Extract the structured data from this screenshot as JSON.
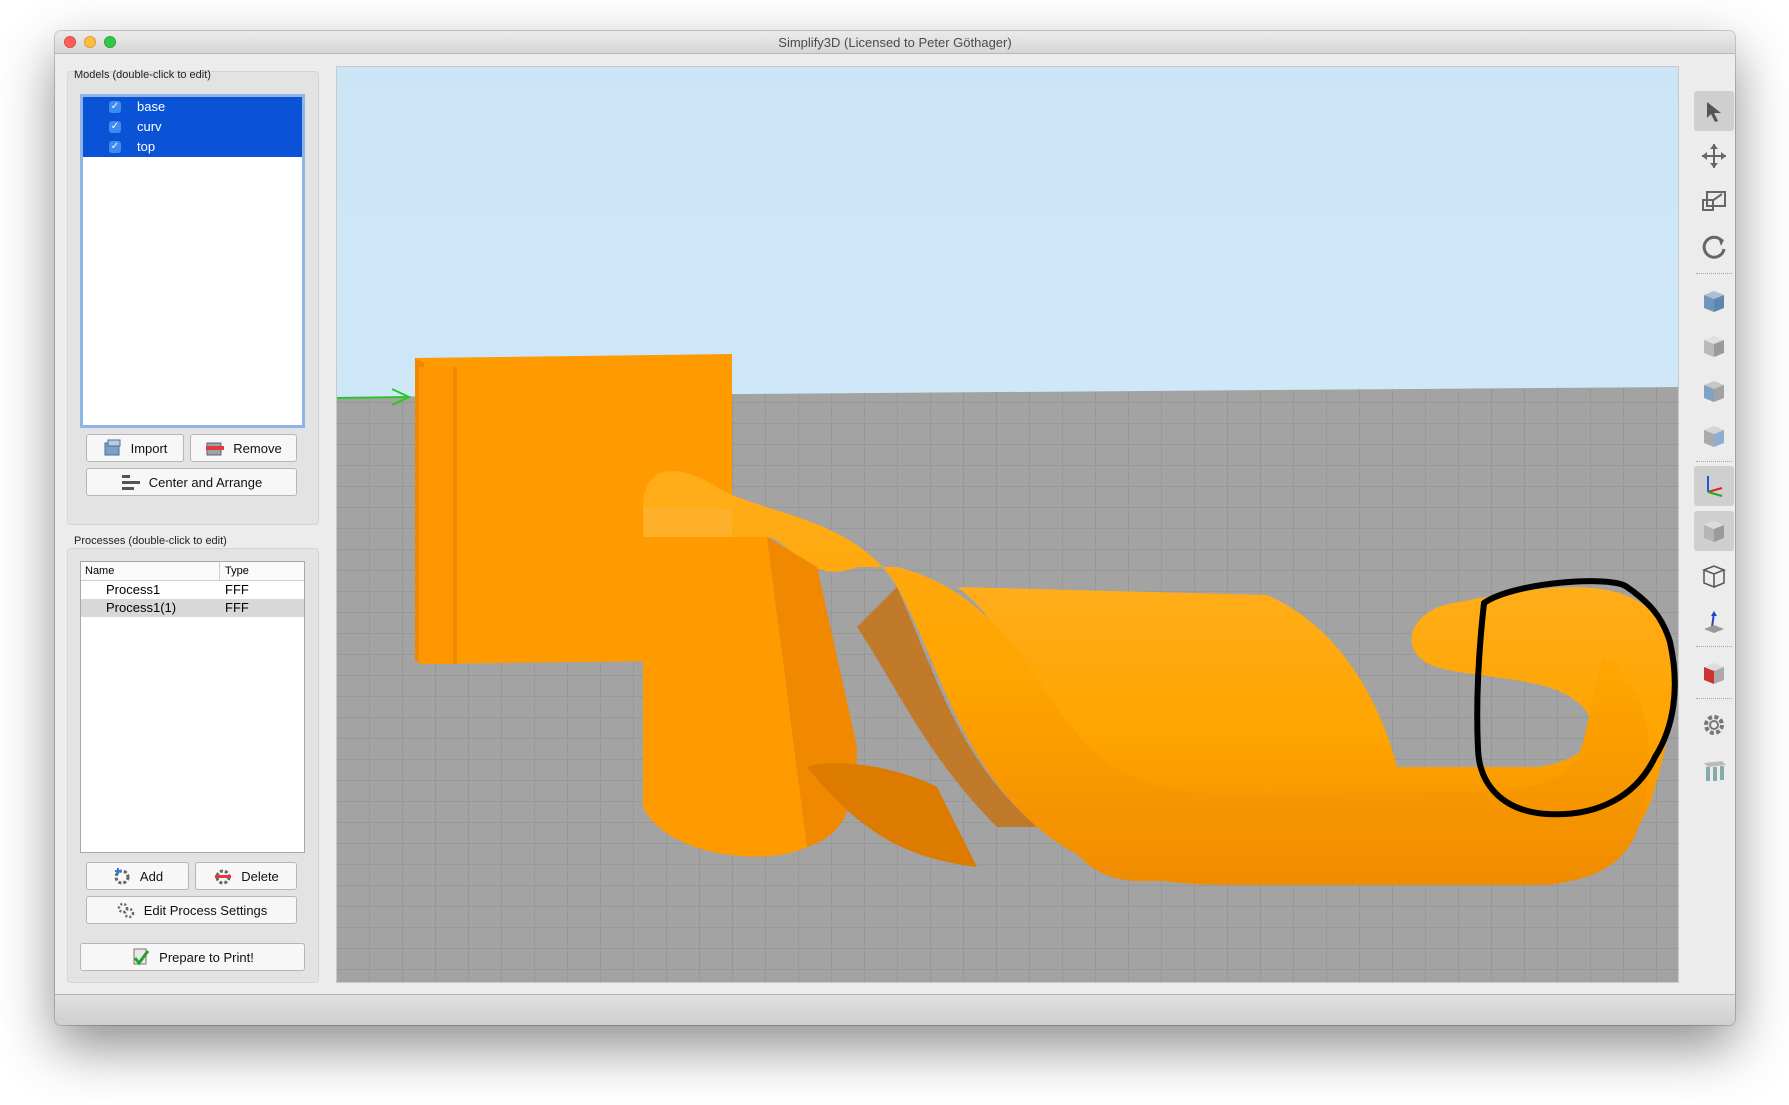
{
  "window": {
    "title": "Simplify3D (Licensed to Peter Göthager)"
  },
  "models": {
    "label": "Models (double-click to edit)",
    "items": [
      {
        "name": "base",
        "checked": true
      },
      {
        "name": "curv",
        "checked": true
      },
      {
        "name": "top",
        "checked": true
      }
    ],
    "import_label": "Import",
    "remove_label": "Remove",
    "center_label": "Center and Arrange"
  },
  "processes": {
    "label": "Processes (double-click to edit)",
    "columns": [
      "Name",
      "Type"
    ],
    "rows": [
      {
        "name": "Process1",
        "type": "FFF",
        "selected": false
      },
      {
        "name": "Process1(1)",
        "type": "FFF",
        "selected": true
      }
    ],
    "add_label": "Add",
    "delete_label": "Delete",
    "edit_label": "Edit Process Settings",
    "prepare_label": "Prepare to Print!"
  },
  "toolbar": {
    "tools": [
      "select-icon",
      "move-icon",
      "scale-icon",
      "rotate-icon",
      "view-top-icon",
      "view-front-icon",
      "view-side-icon",
      "view-iso-icon",
      "axes-icon",
      "solid-view-icon",
      "wireframe-icon",
      "normals-icon",
      "cross-section-icon",
      "settings-gear-icon",
      "supports-icon"
    ]
  },
  "colors": {
    "model": "#ff9a00",
    "sky": "#cde6f7",
    "bed": "#a3a3a3",
    "selection": "#0a53d6",
    "annotation": "#000000"
  }
}
